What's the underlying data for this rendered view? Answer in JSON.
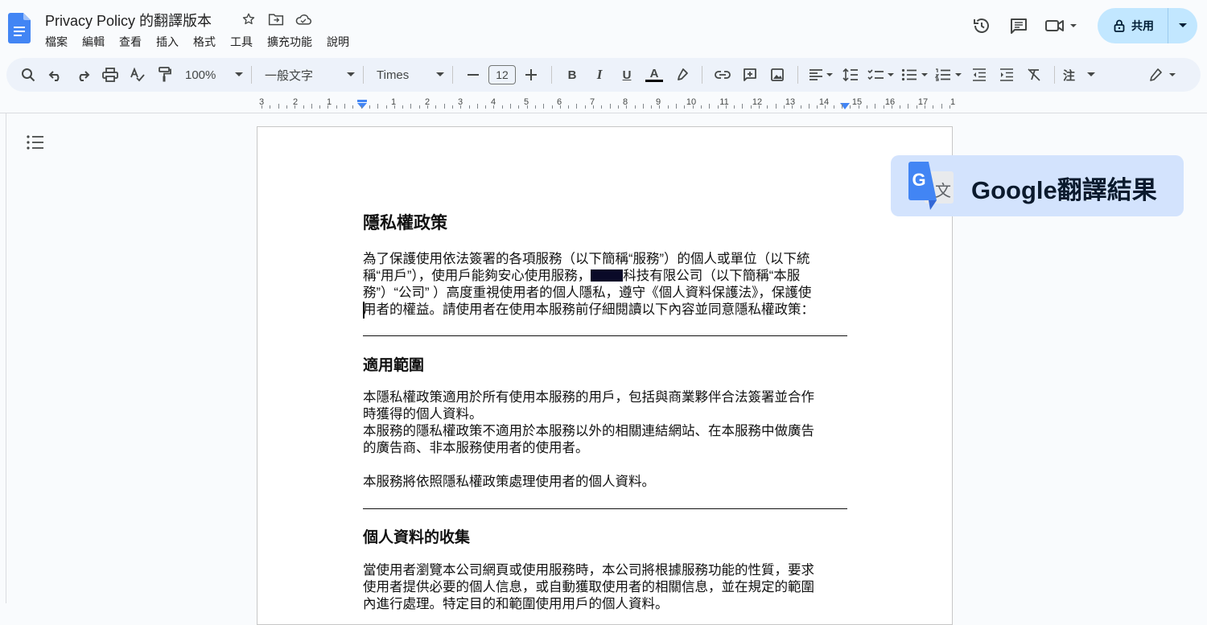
{
  "app": {
    "doc_title": "Privacy Policy 的翻譯版本",
    "menu": [
      "檔案",
      "編輯",
      "查看",
      "插入",
      "格式",
      "工具",
      "擴充功能",
      "說明"
    ],
    "share_label": "共用"
  },
  "toolbar": {
    "zoom": "100%",
    "style": "一般文字",
    "font": "Times",
    "font_size": "12",
    "bold": "B",
    "italic": "I",
    "underline": "U",
    "text_color": "A",
    "notes": "注"
  },
  "ruler": {
    "labels": [
      "3",
      "2",
      "1",
      "1",
      "2",
      "3",
      "4",
      "5",
      "6",
      "7",
      "8",
      "9",
      "10",
      "11",
      "12",
      "13",
      "14",
      "15",
      "16",
      "17",
      "1"
    ]
  },
  "document": {
    "heading": "隱私權政策",
    "intro": {
      "line1": "為了保護使用依法簽署的各項服務（以下簡稱“服務”）的個人或單位（以下統",
      "line2a": "稱“用戶”），使用戶能夠安心使用服務，",
      "line2b": "科技有限公司（以下簡稱“本服",
      "line3": "務”）“公司” ）高度重視使用者的個人隱私，遵守《個人資料保護法》，保護使",
      "line4": "用者的權益。請使用者在使用本服務前仔細閱讀以下內容並同意隱私權政策："
    },
    "section1": {
      "title": "適用範圍",
      "p1_line1": "本隱私權政策適用於所有使用本服務的用戶，包括與商業夥伴合法簽署並合作",
      "p1_line2": "時獲得的個人資料。",
      "p2_line1": "本服務的隱私權政策不適用於本服務以外的相關連結網站、在本服務中做廣告",
      "p2_line2": "的廣告商、非本服務使用者的使用者。",
      "p3": "本服務將依照隱私權政策處理使用者的個人資料。"
    },
    "section2": {
      "title": "個人資料的收集",
      "p1_line1": "當使用者瀏覽本公司網頁或使用服務時，本公司將根據服務功能的性質，要求",
      "p1_line2": "使用者提供必要的個人信息，或自動獲取使用者的相關信息，並在規定的範圍",
      "p1_line3": "內進行處理。特定目的和範圍使用用戶的個人資料。"
    }
  },
  "overlay": {
    "label": "Google翻譯結果",
    "logo_letter_g": "G",
    "logo_letter_wen": "文"
  },
  "colors": {
    "share_bg": "#c2e7ff",
    "toolbar_bg": "#edf2fa",
    "overlay_bg": "#d3e3fd",
    "docs_blue": "#4285f4"
  }
}
